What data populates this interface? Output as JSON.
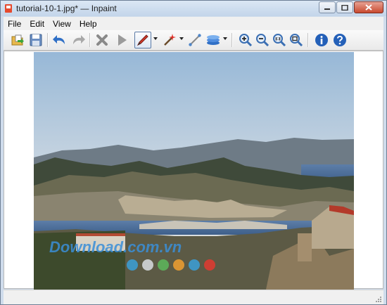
{
  "window": {
    "title": "tutorial-10-1.jpg* — Inpaint"
  },
  "menu": [
    "File",
    "Edit",
    "View",
    "Help"
  ],
  "toolbar": {
    "icons": [
      "open-icon",
      "save-icon",
      "undo-icon",
      "redo-icon",
      "remove-selection-icon",
      "run-inpaint-icon",
      "marker-tool-icon",
      "magic-wand-icon",
      "guide-lines-icon",
      "layers-icon",
      "zoom-in-icon",
      "zoom-out-icon",
      "actual-size-icon",
      "zoom-fit-icon",
      "info-icon",
      "help-icon"
    ]
  },
  "image": {
    "watermark_text": "Download.com.vn"
  },
  "colors": {
    "window_frame": "#cfdcec",
    "toolbar": "#efefef",
    "close_button": "#c8492f",
    "accent_blue": "#2f6fc6"
  }
}
